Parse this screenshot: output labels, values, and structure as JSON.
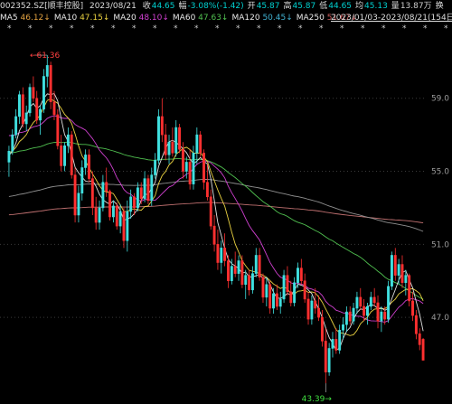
{
  "header": {
    "code": "002352.SZ[顺丰控股]",
    "date": "2023/08/21",
    "items": [
      {
        "label": "收",
        "value": "44.65",
        "color": "#00d0d0"
      },
      {
        "label": "幅",
        "value": "-3.08%(-1.42)",
        "color": "#00d0d0"
      },
      {
        "label": "开",
        "value": "45.87",
        "color": "#00d0d0"
      },
      {
        "label": "高",
        "value": "45.87",
        "color": "#00d0d0"
      },
      {
        "label": "低",
        "value": "44.65",
        "color": "#00d0d0"
      },
      {
        "label": "均",
        "value": "45.13",
        "color": "#00d0d0"
      },
      {
        "label": "量",
        "value": "13.87万",
        "color": "#cccccc"
      },
      {
        "label": "换",
        "value": "",
        "color": "#cccccc"
      }
    ]
  },
  "ma_bar": {
    "items": [
      {
        "label": "MA5",
        "value": "46.12↓",
        "color": "#e8e8e8",
        "vcolor": "#e0a040"
      },
      {
        "label": "MA10",
        "value": "47.15↓",
        "color": "#e8e8e8",
        "vcolor": "#e8d040"
      },
      {
        "label": "MA20",
        "value": "48.10↓",
        "color": "#e8e8e8",
        "vcolor": "#d040d0"
      },
      {
        "label": "MA60",
        "value": "47.63↓",
        "color": "#e8e8e8",
        "vcolor": "#50c050"
      },
      {
        "label": "MA120",
        "value": "50.45↓",
        "color": "#e8e8e8",
        "vcolor": "#40b0d0"
      },
      {
        "label": "MA250",
        "value": "51.67↓",
        "color": "#e8e8e8",
        "vcolor": "#d06060"
      }
    ],
    "range": "2023/01/03-2023/08/21(154日)"
  },
  "chart_data": {
    "type": "candlestick",
    "y_ticks": [
      "59.0",
      "55.0",
      "51.0",
      "47.0"
    ],
    "ylim": [
      42.6,
      62.6
    ],
    "annotations": {
      "high": "61.36",
      "low": "43.39"
    },
    "colors": {
      "up": "#40e0e0",
      "down": "#ff3030",
      "ma5": "#e0e0e0",
      "ma10": "#e8d040",
      "ma20": "#d040d0",
      "ma60": "#50c050",
      "ma120": "#909090",
      "ma250": "#c07070"
    },
    "candles": [
      [
        55.5,
        56.4,
        54.7,
        56.1
      ],
      [
        56.1,
        57.3,
        55.9,
        57.0
      ],
      [
        57.0,
        58.4,
        56.8,
        58.0
      ],
      [
        58.0,
        59.4,
        57.6,
        59.2
      ],
      [
        59.2,
        59.6,
        57.4,
        57.6
      ],
      [
        57.6,
        58.6,
        57.2,
        58.2
      ],
      [
        58.2,
        59.8,
        58.0,
        59.6
      ],
      [
        59.6,
        60.2,
        58.8,
        59.0
      ],
      [
        59.0,
        59.4,
        57.6,
        57.8
      ],
      [
        57.8,
        58.6,
        57.0,
        58.4
      ],
      [
        58.4,
        60.6,
        58.2,
        60.2
      ],
      [
        60.2,
        61.36,
        59.6,
        60.8
      ],
      [
        60.8,
        61.0,
        58.4,
        58.8
      ],
      [
        58.8,
        59.4,
        57.8,
        58.1
      ],
      [
        58.1,
        58.4,
        56.2,
        56.4
      ],
      [
        56.4,
        57.0,
        55.0,
        55.3
      ],
      [
        55.3,
        56.6,
        55.0,
        56.4
      ],
      [
        56.4,
        57.4,
        56.0,
        57.0
      ],
      [
        57.0,
        57.2,
        54.6,
        54.8
      ],
      [
        54.8,
        55.2,
        52.2,
        52.6
      ],
      [
        52.6,
        54.2,
        52.2,
        53.8
      ],
      [
        53.8,
        55.6,
        53.4,
        55.2
      ],
      [
        55.2,
        56.2,
        54.8,
        55.9
      ],
      [
        55.9,
        56.2,
        54.4,
        54.6
      ],
      [
        54.6,
        55.0,
        52.6,
        53.0
      ],
      [
        53.0,
        53.6,
        51.8,
        52.2
      ],
      [
        52.2,
        53.4,
        51.8,
        53.0
      ],
      [
        53.0,
        54.8,
        52.8,
        54.4
      ],
      [
        54.4,
        55.2,
        53.6,
        53.9
      ],
      [
        53.9,
        54.0,
        52.3,
        52.5
      ],
      [
        52.5,
        53.4,
        52.2,
        53.1
      ],
      [
        53.1,
        53.3,
        51.8,
        52.0
      ],
      [
        52.0,
        53.2,
        51.6,
        52.8
      ],
      [
        52.8,
        53.0,
        50.8,
        51.2
      ],
      [
        51.2,
        53.4,
        50.6,
        52.8
      ],
      [
        52.8,
        54.0,
        52.4,
        53.6
      ],
      [
        53.6,
        53.8,
        52.6,
        53.0
      ],
      [
        53.0,
        54.4,
        52.8,
        54.1
      ],
      [
        54.1,
        54.4,
        53.2,
        53.5
      ],
      [
        53.5,
        55.0,
        53.3,
        54.6
      ],
      [
        54.6,
        54.8,
        53.2,
        53.4
      ],
      [
        53.4,
        55.2,
        53.1,
        54.8
      ],
      [
        54.8,
        56.0,
        54.6,
        55.6
      ],
      [
        55.6,
        58.4,
        55.4,
        58.0
      ],
      [
        58.0,
        59.0,
        56.6,
        57.0
      ],
      [
        57.0,
        57.6,
        55.6,
        55.9
      ],
      [
        55.9,
        57.0,
        55.4,
        56.6
      ],
      [
        56.6,
        57.4,
        55.8,
        56.0
      ],
      [
        56.0,
        57.8,
        55.8,
        57.4
      ],
      [
        57.4,
        57.6,
        56.0,
        56.2
      ],
      [
        56.2,
        56.6,
        54.6,
        55.0
      ],
      [
        55.0,
        55.8,
        54.6,
        55.5
      ],
      [
        55.5,
        56.2,
        54.0,
        54.3
      ],
      [
        54.3,
        56.4,
        54.0,
        56.0
      ],
      [
        56.0,
        57.4,
        55.4,
        57.0
      ],
      [
        57.0,
        57.2,
        55.8,
        56.0
      ],
      [
        56.0,
        56.2,
        54.0,
        54.4
      ],
      [
        54.4,
        55.4,
        53.4,
        53.6
      ],
      [
        53.6,
        54.0,
        51.8,
        52.0
      ],
      [
        52.0,
        52.6,
        50.6,
        51.0
      ],
      [
        51.0,
        51.8,
        49.6,
        50.0
      ],
      [
        50.0,
        51.2,
        49.4,
        50.8
      ],
      [
        50.8,
        51.6,
        49.8,
        50.1
      ],
      [
        50.1,
        50.4,
        48.6,
        49.0
      ],
      [
        49.0,
        50.2,
        48.8,
        49.8
      ],
      [
        49.8,
        50.6,
        49.2,
        49.4
      ],
      [
        49.4,
        50.4,
        49.0,
        50.1
      ],
      [
        50.1,
        50.4,
        48.6,
        48.8
      ],
      [
        48.8,
        49.6,
        48.0,
        49.3
      ],
      [
        49.3,
        49.6,
        48.2,
        48.5
      ],
      [
        48.5,
        49.8,
        48.3,
        49.4
      ],
      [
        49.4,
        50.8,
        49.2,
        50.4
      ],
      [
        50.4,
        50.8,
        49.0,
        49.2
      ],
      [
        49.2,
        49.4,
        47.8,
        48.1
      ],
      [
        48.1,
        49.2,
        47.6,
        48.8
      ],
      [
        48.8,
        49.0,
        47.2,
        47.5
      ],
      [
        47.5,
        48.6,
        47.2,
        48.3
      ],
      [
        48.3,
        48.8,
        47.4,
        47.6
      ],
      [
        47.6,
        48.4,
        47.2,
        48.0
      ],
      [
        48.0,
        49.6,
        47.8,
        49.3
      ],
      [
        49.3,
        49.8,
        48.2,
        48.4
      ],
      [
        48.4,
        49.0,
        47.6,
        47.8
      ],
      [
        47.8,
        49.2,
        47.6,
        48.9
      ],
      [
        48.9,
        50.0,
        48.6,
        49.7
      ],
      [
        49.7,
        50.2,
        48.8,
        49.0
      ],
      [
        49.0,
        49.4,
        47.8,
        48.0
      ],
      [
        48.0,
        48.4,
        46.6,
        46.9
      ],
      [
        46.9,
        48.2,
        46.6,
        47.9
      ],
      [
        47.9,
        48.6,
        47.2,
        47.5
      ],
      [
        47.5,
        48.2,
        46.8,
        47.0
      ],
      [
        47.0,
        47.4,
        45.4,
        45.7
      ],
      [
        45.7,
        46.4,
        43.39,
        44.0
      ],
      [
        44.0,
        45.6,
        43.8,
        45.3
      ],
      [
        45.3,
        46.2,
        44.8,
        45.8
      ],
      [
        45.8,
        46.4,
        45.0,
        45.2
      ],
      [
        45.2,
        46.6,
        45.0,
        46.3
      ],
      [
        46.3,
        47.0,
        45.8,
        46.6
      ],
      [
        46.6,
        47.6,
        46.2,
        47.3
      ],
      [
        47.3,
        47.6,
        46.6,
        46.8
      ],
      [
        46.8,
        47.8,
        46.6,
        47.5
      ],
      [
        47.5,
        48.4,
        47.2,
        48.1
      ],
      [
        48.1,
        48.6,
        47.4,
        47.6
      ],
      [
        47.6,
        48.0,
        46.8,
        47.1
      ],
      [
        47.1,
        47.8,
        46.6,
        47.6
      ],
      [
        47.6,
        48.4,
        47.4,
        48.1
      ],
      [
        48.1,
        48.6,
        47.6,
        47.8
      ],
      [
        47.8,
        48.2,
        46.4,
        46.8
      ],
      [
        46.8,
        47.6,
        46.2,
        47.3
      ],
      [
        47.3,
        47.6,
        46.6,
        46.9
      ],
      [
        46.9,
        49.0,
        46.7,
        48.7
      ],
      [
        48.7,
        50.6,
        48.5,
        50.4
      ],
      [
        50.4,
        50.8,
        49.0,
        49.3
      ],
      [
        49.3,
        50.2,
        48.8,
        49.9
      ],
      [
        49.9,
        50.4,
        48.6,
        48.9
      ],
      [
        48.9,
        49.6,
        48.2,
        49.3
      ],
      [
        49.3,
        49.4,
        47.6,
        47.9
      ],
      [
        47.9,
        48.4,
        46.8,
        47.1
      ],
      [
        47.1,
        47.4,
        45.8,
        46.1
      ],
      [
        46.1,
        46.4,
        45.2,
        45.5
      ],
      [
        45.8,
        45.87,
        44.65,
        44.65
      ]
    ]
  }
}
